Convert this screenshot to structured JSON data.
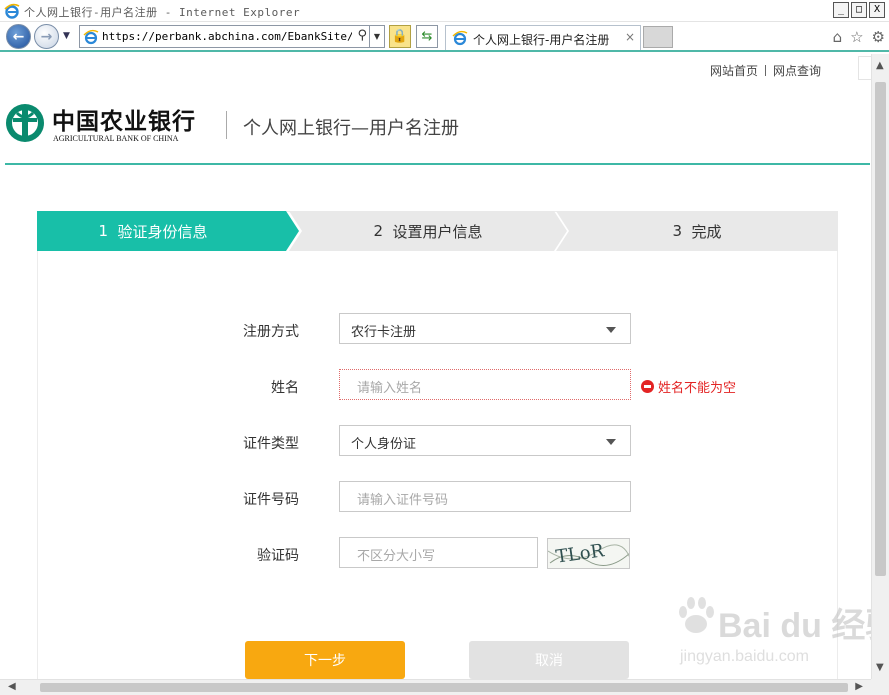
{
  "window": {
    "title": "个人网上银行-用户名注册 - Internet Explorer",
    "controls": [
      "_",
      "□",
      "X"
    ]
  },
  "browser": {
    "url_host": "perbank.abchina.com",
    "url_prefix": "https://",
    "url_path": "/EbankSite/Sel",
    "tab_title": "个人网上银行-用户名注册",
    "tab_close": "×"
  },
  "page": {
    "top_links": [
      "网站首页",
      "网点查询"
    ],
    "bank_name_cn": "中国农业银行",
    "bank_name_en": "AGRICULTURAL BANK OF CHINA",
    "title": "个人网上银行—用户名注册"
  },
  "steps": [
    {
      "number": "1",
      "label": "验证身份信息",
      "active": true
    },
    {
      "number": "2",
      "label": "设置用户信息",
      "active": false
    },
    {
      "number": "3",
      "label": "完成",
      "active": false
    }
  ],
  "form": {
    "register_method": {
      "label": "注册方式",
      "value": "农行卡注册"
    },
    "name": {
      "label": "姓名",
      "placeholder": "请输入姓名",
      "error": "姓名不能为空"
    },
    "id_type": {
      "label": "证件类型",
      "value": "个人身份证"
    },
    "id_number": {
      "label": "证件号码",
      "placeholder": "请输入证件号码"
    },
    "captcha": {
      "label": "验证码",
      "placeholder": "不区分大小写",
      "image_text": "TLoR"
    }
  },
  "buttons": {
    "next": "下一步",
    "cancel": "取消"
  },
  "watermark": {
    "text": "Bai du 经验",
    "url": "jingyan.baidu.com"
  },
  "colors": {
    "accent": "#18bfa8",
    "primary_button": "#f8a810",
    "error": "#e32424",
    "disabled_button": "#e2e2e2"
  }
}
